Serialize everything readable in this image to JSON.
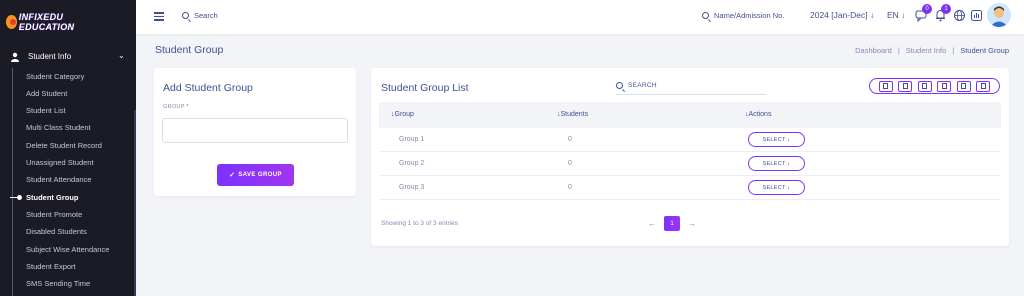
{
  "brand": {
    "logo_text": "INFIXEDU EDUCATION"
  },
  "sidebar": {
    "section_label": "Student Info",
    "items": [
      {
        "label": "Student Category"
      },
      {
        "label": "Add Student"
      },
      {
        "label": "Student List"
      },
      {
        "label": "Multi Class Student"
      },
      {
        "label": "Delete Student Record"
      },
      {
        "label": "Unassigned Student"
      },
      {
        "label": "Student Attendance"
      },
      {
        "label": "Student Group"
      },
      {
        "label": "Student Promote"
      },
      {
        "label": "Disabled Students"
      },
      {
        "label": "Subject Wise Attendance"
      },
      {
        "label": "Student Export"
      },
      {
        "label": "SMS Sending Time"
      }
    ],
    "active_index": 7
  },
  "header": {
    "search_label": "Search",
    "name_search_label": "Name/Admission No.",
    "academic_year": "2024 [Jan-Dec] ↓",
    "language": "EN ↓",
    "message_count": "0",
    "notification_count": "1"
  },
  "page": {
    "title": "Student Group",
    "breadcrumb": [
      "Dashboard",
      "|",
      "Student Info",
      "|",
      "Student Group"
    ]
  },
  "add_form": {
    "title": "Add Student Group",
    "field_label": "GROUP",
    "required_mark": "*",
    "field_value": "",
    "save_label": "SAVE GROUP"
  },
  "list": {
    "title": "Student Group List",
    "search_label": "SEARCH",
    "columns": [
      "↓Group",
      "↓Students",
      "↓Actions"
    ],
    "rows": [
      {
        "group": "Group 1",
        "students": "0",
        "action": "SELECT ↓"
      },
      {
        "group": "Group 2",
        "students": "0",
        "action": "SELECT ↓"
      },
      {
        "group": "Group 3",
        "students": "0",
        "action": "SELECT ↓"
      }
    ],
    "showing_text": "Showing 1 to 3 of 3 entries",
    "prev": "←",
    "next": "→",
    "current_page": "1"
  },
  "colors": {
    "accent": "#7c32ff",
    "sidebar_bg": "#1b1b25",
    "text": "#415094"
  }
}
